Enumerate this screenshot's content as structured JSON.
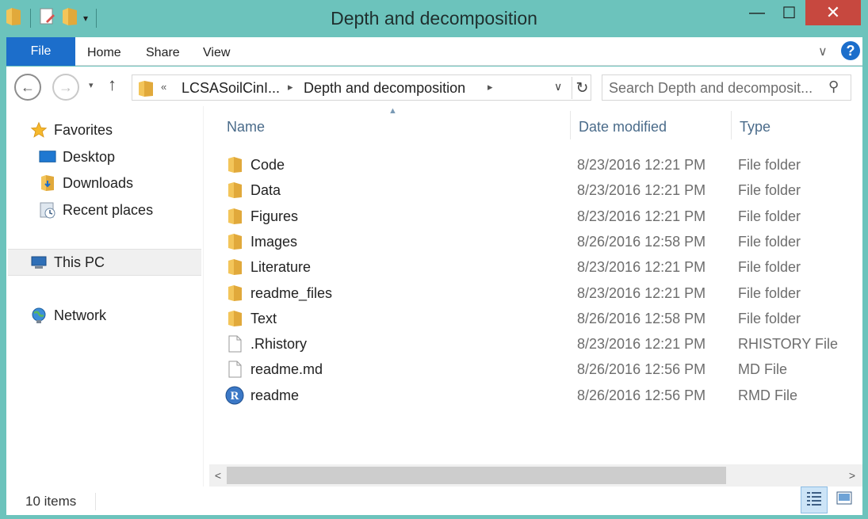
{
  "window": {
    "title": "Depth and decomposition",
    "minimize": "—",
    "maximize": "☐",
    "close": "✕"
  },
  "ribbon": {
    "tabs": [
      "File",
      "Home",
      "Share",
      "View"
    ],
    "expand_glyph": "∨",
    "help_glyph": "?"
  },
  "nav": {
    "back": "←",
    "forward": "→",
    "recent": "▾",
    "up": "↑",
    "overflow": "«",
    "path": [
      "LCSASoilCinI...",
      "Depth and decomposition"
    ],
    "separator": "▸",
    "dropdown": "∨",
    "refresh": "↻",
    "search_placeholder": "Search Depth and decomposit...",
    "search_glyph": "⚲"
  },
  "sidebar": {
    "items": [
      {
        "label": "Favorites",
        "icon": "star-icon"
      },
      {
        "label": "Desktop",
        "icon": "desktop-icon"
      },
      {
        "label": "Downloads",
        "icon": "downloads-icon"
      },
      {
        "label": "Recent places",
        "icon": "recent-places-icon"
      },
      {
        "label": "This PC",
        "icon": "computer-icon"
      },
      {
        "label": "Network",
        "icon": "network-icon"
      }
    ]
  },
  "columns": {
    "name": "Name",
    "date": "Date modified",
    "type": "Type",
    "sort_glyph": "▲"
  },
  "files": [
    {
      "name": "Code",
      "date": "8/23/2016 12:21 PM",
      "type": "File folder",
      "icon": "folder-icon"
    },
    {
      "name": "Data",
      "date": "8/23/2016 12:21 PM",
      "type": "File folder",
      "icon": "folder-icon"
    },
    {
      "name": "Figures",
      "date": "8/23/2016 12:21 PM",
      "type": "File folder",
      "icon": "folder-icon"
    },
    {
      "name": "Images",
      "date": "8/26/2016 12:58 PM",
      "type": "File folder",
      "icon": "folder-icon"
    },
    {
      "name": "Literature",
      "date": "8/23/2016 12:21 PM",
      "type": "File folder",
      "icon": "folder-icon"
    },
    {
      "name": "readme_files",
      "date": "8/23/2016 12:21 PM",
      "type": "File folder",
      "icon": "folder-icon"
    },
    {
      "name": "Text",
      "date": "8/26/2016 12:58 PM",
      "type": "File folder",
      "icon": "folder-icon"
    },
    {
      "name": ".Rhistory",
      "date": "8/23/2016 12:21 PM",
      "type": "RHISTORY File",
      "icon": "file-icon"
    },
    {
      "name": "readme.md",
      "date": "8/26/2016 12:56 PM",
      "type": "MD File",
      "icon": "file-icon"
    },
    {
      "name": "readme",
      "date": "8/26/2016 12:56 PM",
      "type": "RMD File",
      "icon": "r-file-icon"
    }
  ],
  "scroll": {
    "left": "<",
    "right": ">"
  },
  "status": {
    "item_count": "10 items"
  },
  "colors": {
    "frame": "#6cc3bc",
    "file_tab": "#1c6ecb",
    "close_button": "#c7483f",
    "folder": "#e8b84a",
    "column_header": "#4a6b8a"
  }
}
